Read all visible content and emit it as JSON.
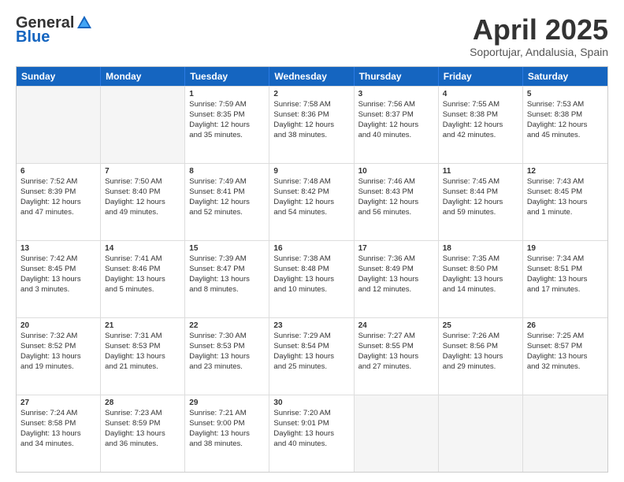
{
  "logo": {
    "general": "General",
    "blue": "Blue"
  },
  "title": "April 2025",
  "location": "Soportujar, Andalusia, Spain",
  "header_days": [
    "Sunday",
    "Monday",
    "Tuesday",
    "Wednesday",
    "Thursday",
    "Friday",
    "Saturday"
  ],
  "rows": [
    [
      {
        "day": "",
        "empty": true
      },
      {
        "day": "",
        "empty": true
      },
      {
        "day": "1",
        "line1": "Sunrise: 7:59 AM",
        "line2": "Sunset: 8:35 PM",
        "line3": "Daylight: 12 hours",
        "line4": "and 35 minutes."
      },
      {
        "day": "2",
        "line1": "Sunrise: 7:58 AM",
        "line2": "Sunset: 8:36 PM",
        "line3": "Daylight: 12 hours",
        "line4": "and 38 minutes."
      },
      {
        "day": "3",
        "line1": "Sunrise: 7:56 AM",
        "line2": "Sunset: 8:37 PM",
        "line3": "Daylight: 12 hours",
        "line4": "and 40 minutes."
      },
      {
        "day": "4",
        "line1": "Sunrise: 7:55 AM",
        "line2": "Sunset: 8:38 PM",
        "line3": "Daylight: 12 hours",
        "line4": "and 42 minutes."
      },
      {
        "day": "5",
        "line1": "Sunrise: 7:53 AM",
        "line2": "Sunset: 8:38 PM",
        "line3": "Daylight: 12 hours",
        "line4": "and 45 minutes."
      }
    ],
    [
      {
        "day": "6",
        "line1": "Sunrise: 7:52 AM",
        "line2": "Sunset: 8:39 PM",
        "line3": "Daylight: 12 hours",
        "line4": "and 47 minutes."
      },
      {
        "day": "7",
        "line1": "Sunrise: 7:50 AM",
        "line2": "Sunset: 8:40 PM",
        "line3": "Daylight: 12 hours",
        "line4": "and 49 minutes."
      },
      {
        "day": "8",
        "line1": "Sunrise: 7:49 AM",
        "line2": "Sunset: 8:41 PM",
        "line3": "Daylight: 12 hours",
        "line4": "and 52 minutes."
      },
      {
        "day": "9",
        "line1": "Sunrise: 7:48 AM",
        "line2": "Sunset: 8:42 PM",
        "line3": "Daylight: 12 hours",
        "line4": "and 54 minutes."
      },
      {
        "day": "10",
        "line1": "Sunrise: 7:46 AM",
        "line2": "Sunset: 8:43 PM",
        "line3": "Daylight: 12 hours",
        "line4": "and 56 minutes."
      },
      {
        "day": "11",
        "line1": "Sunrise: 7:45 AM",
        "line2": "Sunset: 8:44 PM",
        "line3": "Daylight: 12 hours",
        "line4": "and 59 minutes."
      },
      {
        "day": "12",
        "line1": "Sunrise: 7:43 AM",
        "line2": "Sunset: 8:45 PM",
        "line3": "Daylight: 13 hours",
        "line4": "and 1 minute."
      }
    ],
    [
      {
        "day": "13",
        "line1": "Sunrise: 7:42 AM",
        "line2": "Sunset: 8:45 PM",
        "line3": "Daylight: 13 hours",
        "line4": "and 3 minutes."
      },
      {
        "day": "14",
        "line1": "Sunrise: 7:41 AM",
        "line2": "Sunset: 8:46 PM",
        "line3": "Daylight: 13 hours",
        "line4": "and 5 minutes."
      },
      {
        "day": "15",
        "line1": "Sunrise: 7:39 AM",
        "line2": "Sunset: 8:47 PM",
        "line3": "Daylight: 13 hours",
        "line4": "and 8 minutes."
      },
      {
        "day": "16",
        "line1": "Sunrise: 7:38 AM",
        "line2": "Sunset: 8:48 PM",
        "line3": "Daylight: 13 hours",
        "line4": "and 10 minutes."
      },
      {
        "day": "17",
        "line1": "Sunrise: 7:36 AM",
        "line2": "Sunset: 8:49 PM",
        "line3": "Daylight: 13 hours",
        "line4": "and 12 minutes."
      },
      {
        "day": "18",
        "line1": "Sunrise: 7:35 AM",
        "line2": "Sunset: 8:50 PM",
        "line3": "Daylight: 13 hours",
        "line4": "and 14 minutes."
      },
      {
        "day": "19",
        "line1": "Sunrise: 7:34 AM",
        "line2": "Sunset: 8:51 PM",
        "line3": "Daylight: 13 hours",
        "line4": "and 17 minutes."
      }
    ],
    [
      {
        "day": "20",
        "line1": "Sunrise: 7:32 AM",
        "line2": "Sunset: 8:52 PM",
        "line3": "Daylight: 13 hours",
        "line4": "and 19 minutes."
      },
      {
        "day": "21",
        "line1": "Sunrise: 7:31 AM",
        "line2": "Sunset: 8:53 PM",
        "line3": "Daylight: 13 hours",
        "line4": "and 21 minutes."
      },
      {
        "day": "22",
        "line1": "Sunrise: 7:30 AM",
        "line2": "Sunset: 8:53 PM",
        "line3": "Daylight: 13 hours",
        "line4": "and 23 minutes."
      },
      {
        "day": "23",
        "line1": "Sunrise: 7:29 AM",
        "line2": "Sunset: 8:54 PM",
        "line3": "Daylight: 13 hours",
        "line4": "and 25 minutes."
      },
      {
        "day": "24",
        "line1": "Sunrise: 7:27 AM",
        "line2": "Sunset: 8:55 PM",
        "line3": "Daylight: 13 hours",
        "line4": "and 27 minutes."
      },
      {
        "day": "25",
        "line1": "Sunrise: 7:26 AM",
        "line2": "Sunset: 8:56 PM",
        "line3": "Daylight: 13 hours",
        "line4": "and 29 minutes."
      },
      {
        "day": "26",
        "line1": "Sunrise: 7:25 AM",
        "line2": "Sunset: 8:57 PM",
        "line3": "Daylight: 13 hours",
        "line4": "and 32 minutes."
      }
    ],
    [
      {
        "day": "27",
        "line1": "Sunrise: 7:24 AM",
        "line2": "Sunset: 8:58 PM",
        "line3": "Daylight: 13 hours",
        "line4": "and 34 minutes."
      },
      {
        "day": "28",
        "line1": "Sunrise: 7:23 AM",
        "line2": "Sunset: 8:59 PM",
        "line3": "Daylight: 13 hours",
        "line4": "and 36 minutes."
      },
      {
        "day": "29",
        "line1": "Sunrise: 7:21 AM",
        "line2": "Sunset: 9:00 PM",
        "line3": "Daylight: 13 hours",
        "line4": "and 38 minutes."
      },
      {
        "day": "30",
        "line1": "Sunrise: 7:20 AM",
        "line2": "Sunset: 9:01 PM",
        "line3": "Daylight: 13 hours",
        "line4": "and 40 minutes."
      },
      {
        "day": "",
        "empty": true,
        "shaded": true
      },
      {
        "day": "",
        "empty": true,
        "shaded": true
      },
      {
        "day": "",
        "empty": true,
        "shaded": true
      }
    ]
  ]
}
